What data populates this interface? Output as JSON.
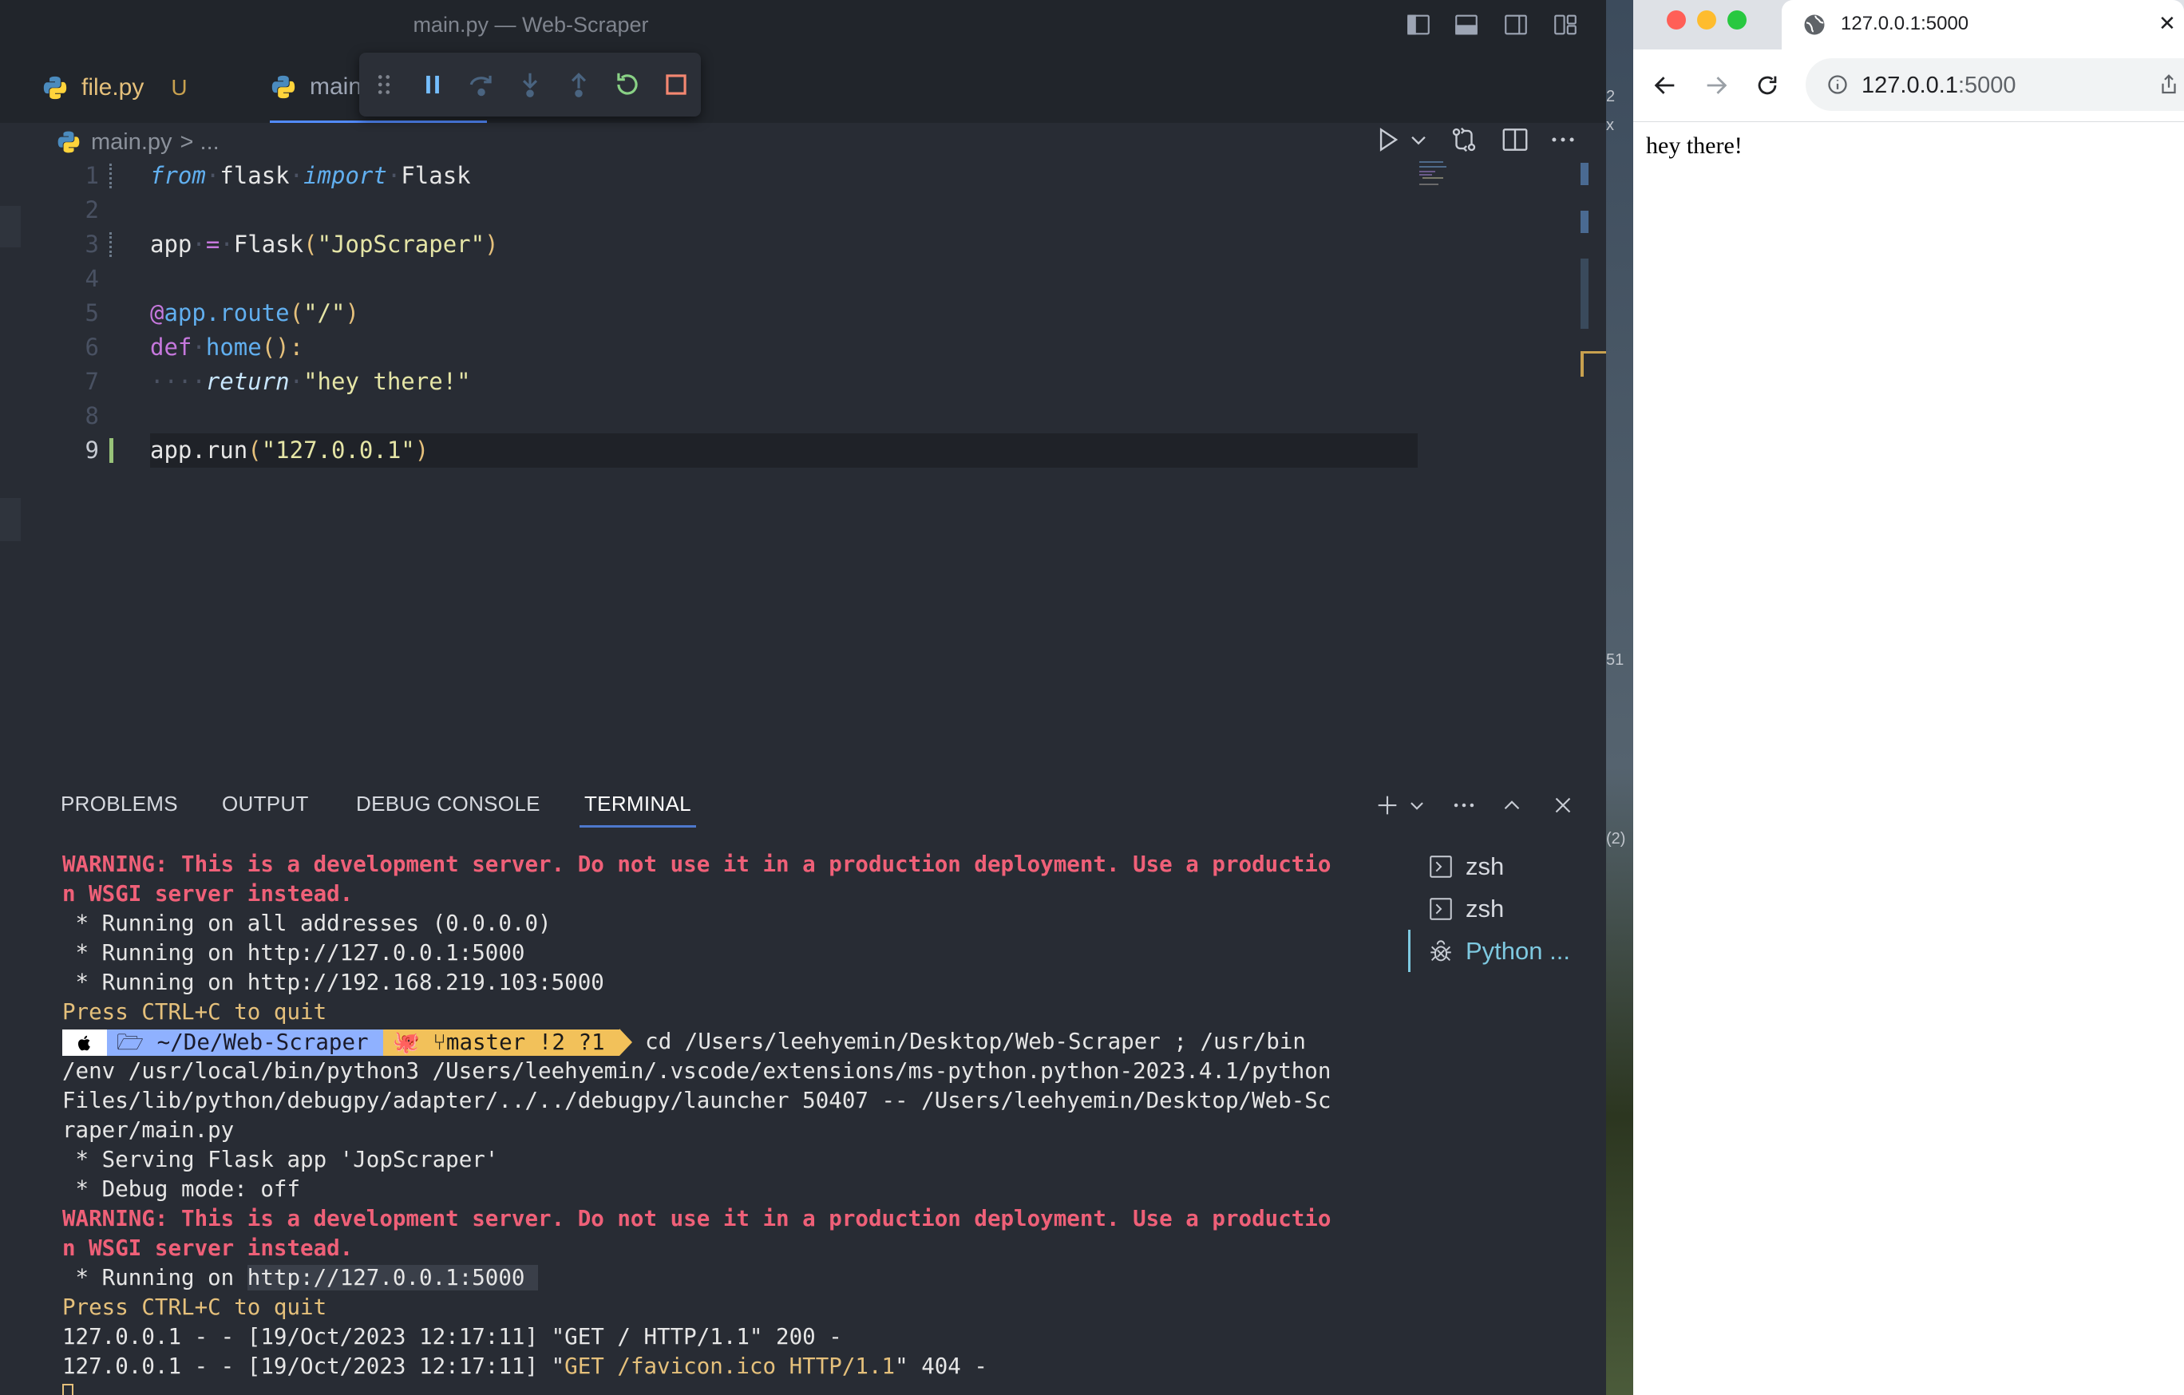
{
  "vscode": {
    "window_title": "main.py — Web-Scraper",
    "tabs": {
      "file": {
        "label": "file.py",
        "status": "U"
      },
      "main": {
        "label": "main"
      }
    },
    "breadcrumb": {
      "file": "main.py",
      "rest": "> ..."
    },
    "code_lines": {
      "l1": {
        "n": "1",
        "kw1": "from",
        "mod": "flask",
        "kw2": "import",
        "name": "Flask"
      },
      "l2": {
        "n": "2"
      },
      "l3": {
        "n": "3",
        "var": "app",
        "eq": "=",
        "call": "Flask",
        "arg": "\"JopScraper\""
      },
      "l4": {
        "n": "4"
      },
      "l5": {
        "n": "5",
        "at": "@",
        "dec": "app.route",
        "arg": "\"/\""
      },
      "l6": {
        "n": "6",
        "kw": "def",
        "fn": "home",
        "rest": "():"
      },
      "l7": {
        "n": "7",
        "kw": "return",
        "val": "\"hey there!\""
      },
      "l8": {
        "n": "8"
      },
      "l9": {
        "n": "9",
        "obj": "app.run",
        "arg": "\"127.0.0.1\""
      }
    },
    "panel": {
      "tabs": [
        "PROBLEMS",
        "OUTPUT",
        "DEBUG CONSOLE",
        "TERMINAL"
      ],
      "active_tab": "TERMINAL"
    },
    "terminal": {
      "warn1a": "WARNING: This is a development server. Do not use it in a production deployment. Use a productio",
      "warn1b": "n WSGI server instead.",
      "run_all": " * Running on all addresses (0.0.0.0)",
      "run_local": " * Running on http://127.0.0.1:5000",
      "run_lan": " * Running on http://192.168.219.103:5000",
      "quit1": "Press CTRL+C to quit",
      "prompt_dir": "~/De/Web-Scraper",
      "prompt_branch": "master !2 ?1",
      "cmd1": " cd /Users/leehyemin/Desktop/Web-Scraper ; /usr/bin",
      "cmd2": "/env /usr/local/bin/python3 /Users/leehyemin/.vscode/extensions/ms-python.python-2023.4.1/python",
      "cmd3": "Files/lib/python/debugpy/adapter/../../debugpy/launcher 50407 -- /Users/leehyemin/Desktop/Web-Sc",
      "cmd4": "raper/main.py",
      "serving": " * Serving Flask app 'JopScraper'",
      "debug_mode": " * Debug mode: off",
      "warn2a": "WARNING: This is a development server. Do not use it in a production deployment. Use a productio",
      "warn2b": "n WSGI server instead.",
      "run2_prefix": " * Running on ",
      "run2_url": "http://127.0.0.1:5000 ",
      "quit2": "Press CTRL+C to quit",
      "log1": "127.0.0.1 - - [19/Oct/2023 12:17:11] \"GET / HTTP/1.1\" 200 -",
      "log2_prefix": "127.0.0.1 - - [19/Oct/2023 12:17:11] \"",
      "log2_req": "GET /favicon.ico HTTP/1.1",
      "log2_suffix": "\" 404 -"
    },
    "terminal_list": [
      "zsh",
      "zsh",
      "Python ..."
    ]
  },
  "background_fragments": {
    "a": "2",
    "b": "x",
    "c": "51",
    "d": "(2)"
  },
  "browser": {
    "tab_title": "127.0.0.1:5000",
    "tab_close": "✕",
    "url_host": "127.0.0.1",
    "url_port": ":5000",
    "page_text": "hey there!"
  },
  "colors": {
    "editor_bg": "#282c34",
    "accent_blue": "#528bff",
    "warning_red": "#ef6078",
    "terminal_yellow": "#e5c07b",
    "browser_bg": "#ffffff"
  }
}
